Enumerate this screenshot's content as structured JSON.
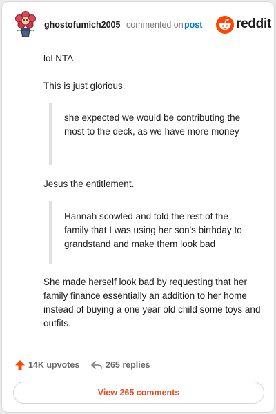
{
  "header": {
    "username": "ghostofumich2005",
    "action_text": "commented on",
    "post_link": "post",
    "brand_name": "reddit",
    "brand_icon": "reddit-snoo-icon",
    "avatar_icon": "flower-avatar-icon",
    "accent_color": "#ff4500"
  },
  "comment": {
    "p1": "lol NTA",
    "p2": "This is just glorious.",
    "quote1": "she expected we would be contributing the most to the deck, as we have more money",
    "p3": "Jesus the entitlement.",
    "quote2": "Hannah scowled and told the rest of the family that I was using her son's birthday to grandstand and make them look bad",
    "p4": "She made herself look bad by requesting that her family finance essentially an addition to her home instead of buying a one year old child some toys and outfits."
  },
  "footer": {
    "upvotes": "14K upvotes",
    "replies": "265 replies",
    "view_comments": "View 265 comments",
    "upvote_icon": "upvote-arrow-icon",
    "reply_icon": "reply-arrow-icon",
    "upvote_color": "#ff4500",
    "link_color": "#e84a1e"
  }
}
